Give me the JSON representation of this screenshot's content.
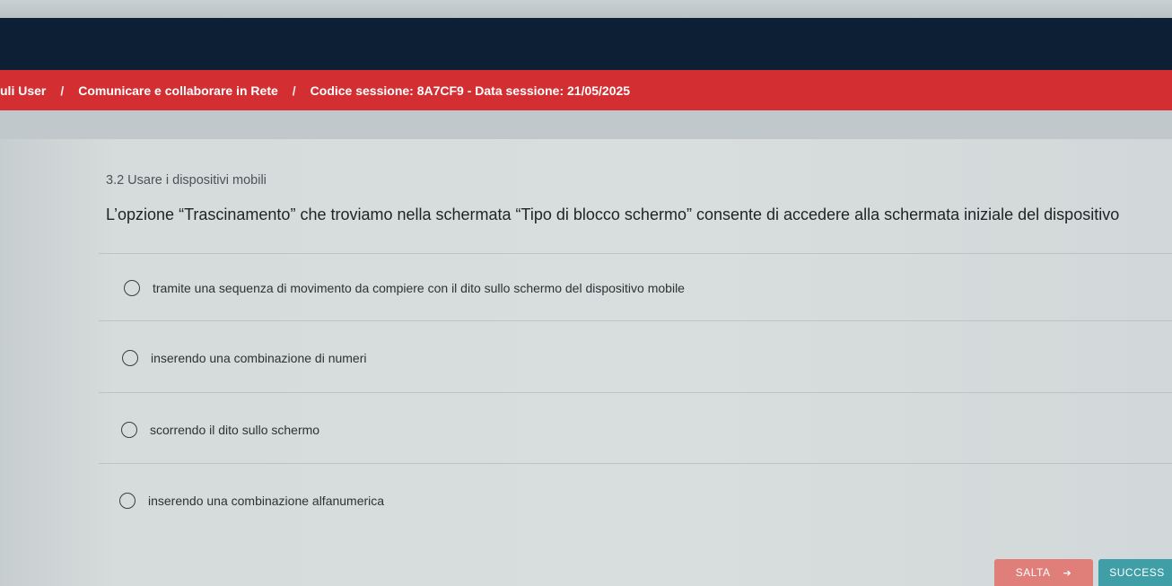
{
  "breadcrumb": {
    "items": [
      "uli User",
      "Comunicare e collaborare in Rete",
      "Codice sessione: 8A7CF9 - Data sessione: 21/05/2025"
    ],
    "separator": "/"
  },
  "quiz": {
    "section_title": "3.2 Usare i dispositivi mobili",
    "question": "L’opzione “Trascinamento” che troviamo nella schermata “Tipo di blocco schermo” consente di accedere alla schermata iniziale del dispositivo",
    "options": [
      "tramite una sequenza di movimento da compiere con il dito sullo schermo del dispositivo mobile",
      "inserendo una combinazione di numeri",
      "scorrendo il dito sullo schermo",
      "inserendo una combinazione alfanumerica"
    ]
  },
  "actions": {
    "skip_label": "SALTA",
    "skip_icon": "arrow-right-icon",
    "success_label": "SUCCESS"
  },
  "colors": {
    "navbar": "#0d1f35",
    "breadcrumb_bar": "#d32f32",
    "skip_button": "#e07f79",
    "success_button": "#3f9ea6"
  }
}
